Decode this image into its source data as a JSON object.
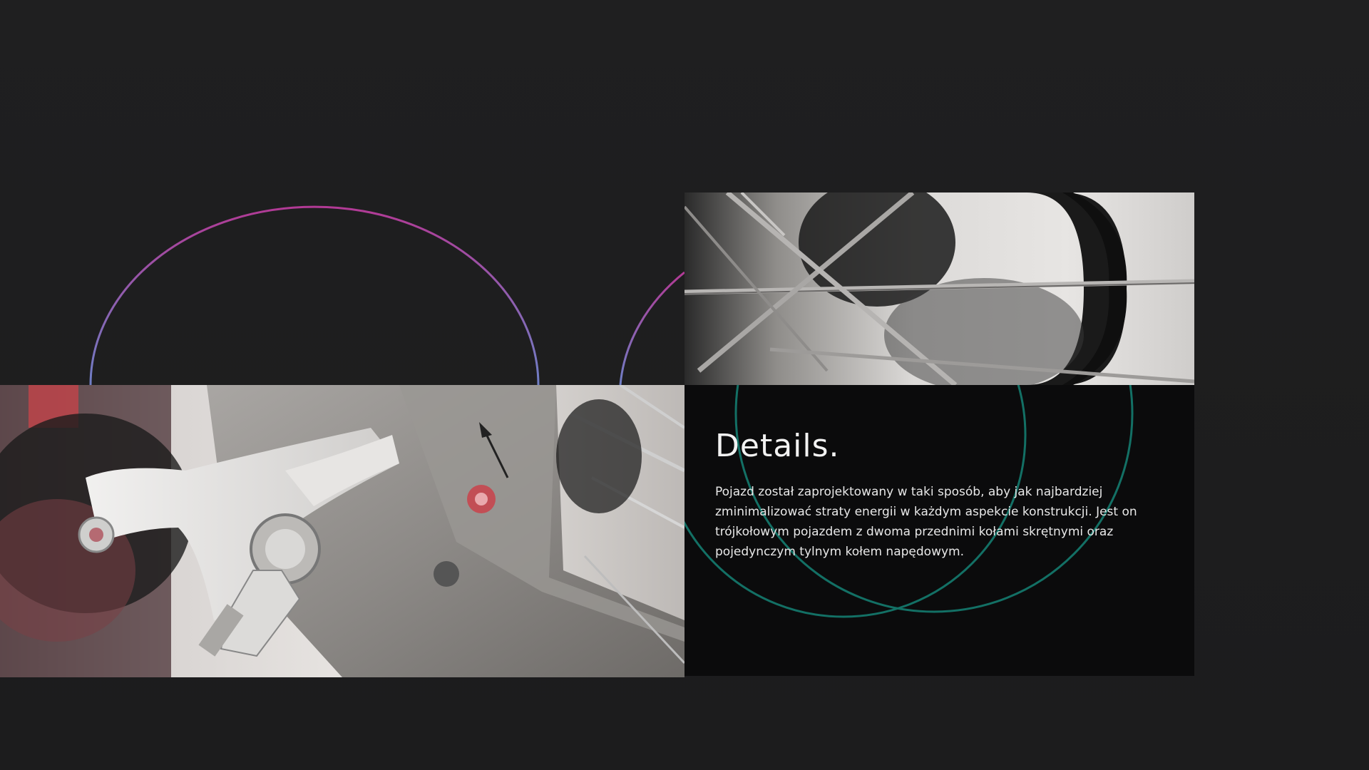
{
  "details": {
    "title": "Details.",
    "body": "Pojazd został zaprojektowany w taki sposób, aby jak najbardziej zminimalizować straty energii w każdym aspekcie konstrukcji. Jest on trójkołowym pojazdem z dwoma przednimi kołami skrętnymi oraz pojedynczym tylnym kołem napędowym."
  },
  "images": [
    {
      "name": "brake-caliper-photo",
      "icon": "bicycle-brake-closeup"
    },
    {
      "name": "wheel-spokes-photo",
      "icon": "wheel-spokes-closeup"
    }
  ],
  "colors": {
    "background": "#1e1e1f",
    "panel": "#0b0b0c",
    "arc_gradient_start": "#b23a95",
    "arc_gradient_end": "#6f7fc6",
    "ring_color": "#137065",
    "text": "#f2f2f2"
  }
}
